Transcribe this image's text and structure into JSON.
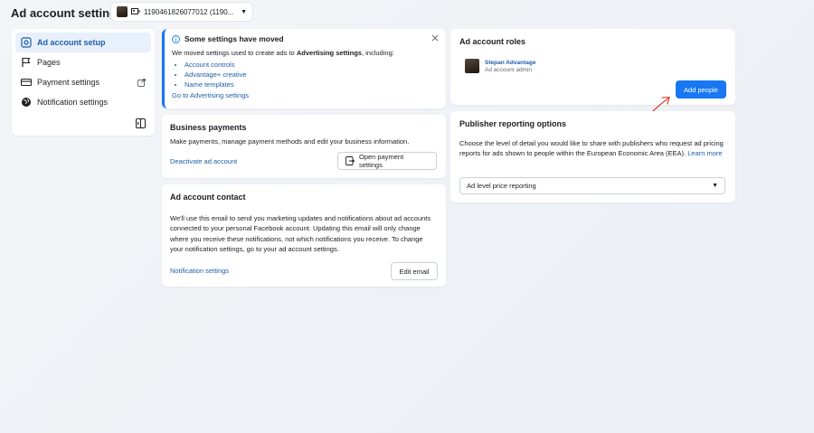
{
  "header": {
    "title": "Ad account settings",
    "account_selector": "1190461826077012 (1190..."
  },
  "sidebar": {
    "items": [
      {
        "label": "Ad account setup",
        "icon": "gear-icon",
        "active": true
      },
      {
        "label": "Pages",
        "icon": "flag-icon"
      },
      {
        "label": "Payment settings",
        "icon": "credit-card-icon",
        "external": true
      },
      {
        "label": "Notification settings",
        "icon": "globe-icon"
      }
    ]
  },
  "notice": {
    "title": "Some settings have moved",
    "body_prefix": "We moved settings used to create ads to ",
    "body_bold": "Advertising settings",
    "body_suffix": ", including:",
    "list": [
      "Account controls",
      "Advantage+ creative",
      "Name templates"
    ],
    "link": "Go to Advertising settings"
  },
  "business_payments": {
    "title": "Business payments",
    "description": "Make payments, manage payment methods and edit your business information.",
    "deactivate_link": "Deactivate ad account",
    "open_button": "Open payment settings"
  },
  "ad_account_contact": {
    "title": "Ad account contact",
    "description": "We'll use this email to send you marketing updates and notifications about ad accounts connected to your personal Facebook account. Updating this email will only change where you receive these notifications, not which notifications you receive. To change your notification settings, go to your ad account settings.",
    "notification_link": "Notification settings",
    "edit_button": "Edit email"
  },
  "ad_account_roles": {
    "title": "Ad account roles",
    "member_name": "Stepan Advantage",
    "member_role": "Ad account admin",
    "add_button": "Add people"
  },
  "publisher_reporting": {
    "title": "Publisher reporting options",
    "description": "Choose the level of detail you would like to share with publishers who request ad pricing reports for ads shown to people within the European Economic Area (EEA).",
    "learn_more": "Learn more",
    "select_value": "Ad level price reporting"
  },
  "colors": {
    "accent": "#1877f2",
    "link": "#1d5fa8",
    "annotation_arrow": "#e0483a"
  }
}
